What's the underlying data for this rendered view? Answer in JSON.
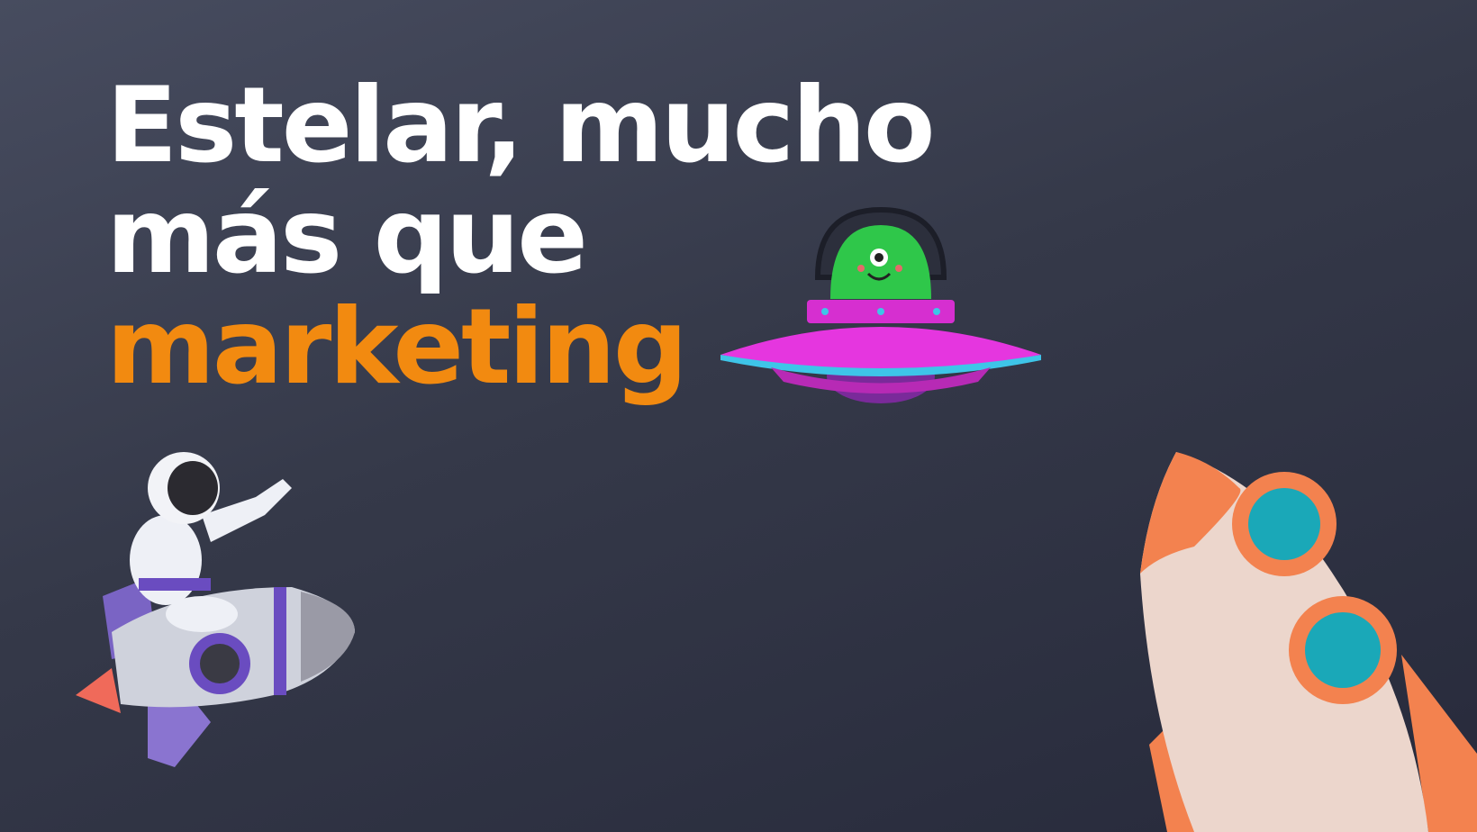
{
  "hero": {
    "line1": "Estelar, mucho",
    "line2": "más que",
    "line3": "marketing"
  },
  "colors": {
    "background_top": "#474c5f",
    "background_bottom": "#272a3b",
    "text": "#ffffff",
    "accent": "#f28a10"
  },
  "illustrations": [
    "ufo-alien",
    "astronaut-on-rocket",
    "orange-rocket"
  ]
}
